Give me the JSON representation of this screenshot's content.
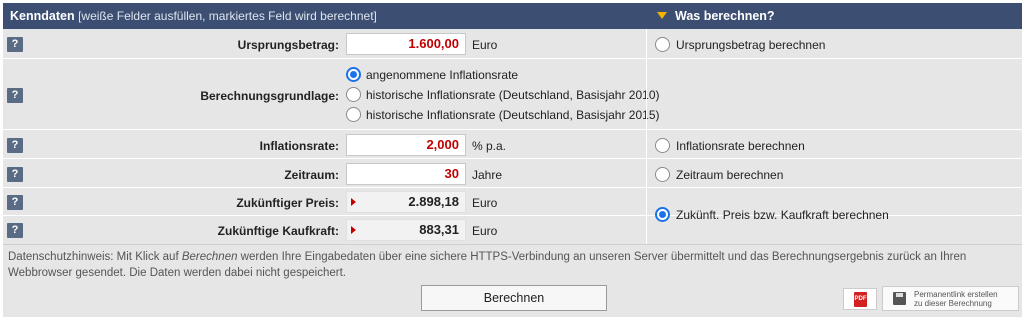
{
  "header": {
    "title": "Kenndaten",
    "subtitle": "[weiße Felder ausfüllen, markiertes Feld wird berechnet]",
    "right_title": "Was berechnen?"
  },
  "help_label": "?",
  "fields": {
    "ursprungsbetrag": {
      "label": "Ursprungsbetrag:",
      "value": "1.600,00",
      "unit": "Euro",
      "calc_option": "Ursprungsbetrag berechnen"
    },
    "berechnungsgrundlage": {
      "label": "Berechnungsgrundlage:",
      "options": [
        "angenommene Inflationsrate",
        "historische Inflationsrate (Deutschland, Basisjahr 2010)",
        "historische Inflationsrate (Deutschland, Basisjahr 2015)"
      ],
      "selected": 0
    },
    "inflationsrate": {
      "label": "Inflationsrate:",
      "value": "2,000",
      "unit": "% p.a.",
      "calc_option": "Inflationsrate berechnen"
    },
    "zeitraum": {
      "label": "Zeitraum:",
      "value": "30",
      "unit": "Jahre",
      "calc_option": "Zeitraum berechnen"
    },
    "zukuenftiger_preis": {
      "label": "Zukünftiger Preis:",
      "value": "2.898,18",
      "unit": "Euro"
    },
    "zukuenftige_kaufkraft": {
      "label": "Zukünftige Kaufkraft:",
      "value": "883,31",
      "unit": "Euro"
    },
    "preis_kaufkraft_option": "Zukünft. Preis bzw. Kaufkraft berechnen"
  },
  "selected_calc": "preis_kaufkraft",
  "privacy_note": {
    "prefix": "Datenschutzhinweis: Mit Klick auf ",
    "emphasis": "Berechnen",
    "suffix": " werden Ihre Eingabedaten über eine sichere HTTPS-Verbindung an unseren Server übermittelt und das Berechnungsergebnis zurück an Ihren Webbrowser gesendet. Die Daten werden dabei nicht gespeichert."
  },
  "buttons": {
    "calculate": "Berechnen",
    "pdf_icon_text": "PDF",
    "permalink_line1": "Permanentlink erstellen",
    "permalink_line2": "zu dieser Berechnung"
  },
  "colors": {
    "header_bg": "#3c4f73",
    "accent_triangle": "#f2b400",
    "input_value": "#c00000",
    "radio_selected": "#1a73e8",
    "panel_bg": "#e6e6e6"
  }
}
